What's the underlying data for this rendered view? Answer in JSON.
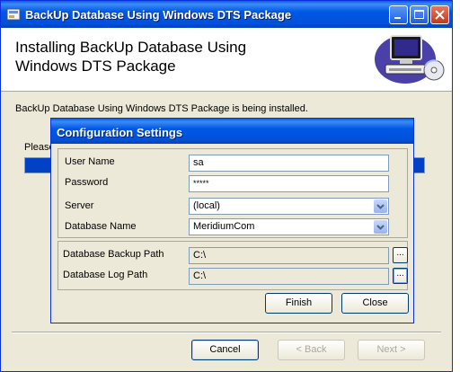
{
  "window": {
    "title": "BackUp Database Using Windows DTS Package",
    "header_title": "Installing BackUp Database Using Windows DTS Package",
    "status_text": "BackUp Database Using Windows DTS Package is being installed.",
    "please_text": "Please",
    "progress": 1.0,
    "buttons": {
      "cancel": "Cancel",
      "back": "< Back",
      "next": "Next >"
    }
  },
  "dialog": {
    "title": "Configuration Settings",
    "fields": {
      "user_name": {
        "label": "User Name",
        "value": "sa"
      },
      "password": {
        "label": "Password",
        "value": "*****"
      },
      "server": {
        "label": "Server",
        "value": "(local)"
      },
      "database_name": {
        "label": "Database Name",
        "value": "MeridiumCom"
      },
      "backup_path": {
        "label": "Database Backup Path",
        "value": "C:\\"
      },
      "log_path": {
        "label": "Database Log Path",
        "value": "C:\\"
      }
    },
    "browse_label": "...",
    "buttons": {
      "finish": "Finish",
      "close": "Close"
    }
  },
  "colors": {
    "titlebar": "#0058e6",
    "progress": "#0041c6",
    "close": "#c4381a"
  }
}
